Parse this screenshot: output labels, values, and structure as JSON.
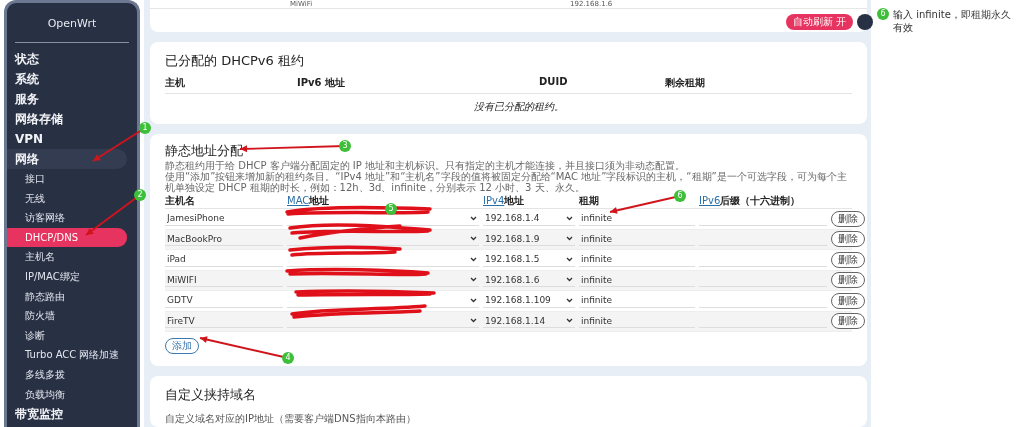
{
  "sidebar": {
    "title": "OpenWrt",
    "items": [
      {
        "label": "状态",
        "expanded": false
      },
      {
        "label": "系统",
        "expanded": false
      },
      {
        "label": "服务",
        "expanded": false
      },
      {
        "label": "网络存储",
        "expanded": false
      },
      {
        "label": "VPN",
        "expanded": false
      },
      {
        "label": "网络",
        "expanded": true,
        "children": [
          {
            "label": "接口",
            "selected": false
          },
          {
            "label": "无线",
            "selected": false
          },
          {
            "label": "访客网络",
            "selected": false
          },
          {
            "label": "DHCP/DNS",
            "selected": true
          },
          {
            "label": "主机名",
            "selected": false
          },
          {
            "label": "IP/MAC绑定",
            "selected": false
          },
          {
            "label": "静态路由",
            "selected": false
          },
          {
            "label": "防火墙",
            "selected": false
          },
          {
            "label": "诊断",
            "selected": false
          },
          {
            "label": "Turbo ACC 网络加速",
            "selected": false
          },
          {
            "label": "多线多拨",
            "selected": false
          },
          {
            "label": "负载均衡",
            "selected": false
          }
        ]
      },
      {
        "label": "带宽监控",
        "expanded": false
      }
    ]
  },
  "dhcp_leases": {
    "partial_row": [
      "MiWiFi",
      "192.168.1.6"
    ],
    "buttons": [
      {
        "label": "自动刷新 开",
        "kind": "primary"
      },
      {
        "kind": "dark"
      }
    ]
  },
  "dhcpv6_leases": {
    "title": "已分配的 DHCPv6 租约",
    "columns": [
      "主机",
      "IPv6 地址",
      "DUID",
      "剩余租期"
    ],
    "empty_message": "没有已分配的租约。"
  },
  "static_leases": {
    "title": "静态地址分配",
    "description": [
      "静态租约用于给 DHCP 客户端分配固定的 IP 地址和主机标识。只有指定的主机才能连接，并且接口须为非动态配置。",
      "使用“添加”按钮来增加新的租约条目。“IPv4 地址”和“主机名”字段的值将被固定分配给“MAC 地址”字段标识的主机，“租期”是一个可选字段，可为每个主机单独设定 DHCP 租期的时长，例如：12h、3d、infinite，分别表示 12 小时、3 天、永久。"
    ],
    "columns": [
      {
        "label": "主机名"
      },
      {
        "link": "MAC",
        "label": "地址"
      },
      {
        "link": "IPv4",
        "label": "地址"
      },
      {
        "label": "租期"
      },
      {
        "link": "IPv6",
        "label": "后缀（十六进制）"
      }
    ],
    "rows": [
      {
        "hostname": "JamesiPhone",
        "ipv4": "192.168.1.4",
        "lease": "infinite",
        "delete_button": "删除"
      },
      {
        "hostname": "MacBookPro",
        "ipv4": "192.168.1.9",
        "lease": "infinite",
        "delete_button": "删除"
      },
      {
        "hostname": "iPad",
        "ipv4": "192.168.1.5",
        "lease": "infinite",
        "delete_button": "删除"
      },
      {
        "hostname": "MiWIFI",
        "ipv4": "192.168.1.6",
        "lease": "infinite",
        "delete_button": "删除"
      },
      {
        "hostname": "GDTV",
        "ipv4": "192.168.1.109",
        "lease": "infinite",
        "delete_button": "删除"
      },
      {
        "hostname": "FireTV",
        "ipv4": "192.168.1.14",
        "lease": "infinite",
        "delete_button": "删除"
      }
    ],
    "add_button": "添加"
  },
  "custom_domains": {
    "title": "自定义挟持域名",
    "description": "自定义域名对应的IP地址（需要客户端DNS指向本路由）"
  },
  "annotations": [
    {
      "number": "1"
    },
    {
      "number": "2"
    },
    {
      "number": "3"
    },
    {
      "number": "4"
    },
    {
      "number": "5"
    },
    {
      "number": "6"
    }
  ],
  "note": {
    "number": "6",
    "text": "输入 infinite，即租期永久有效"
  }
}
